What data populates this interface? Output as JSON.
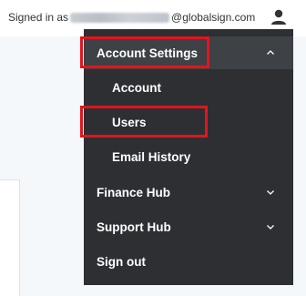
{
  "header": {
    "signed_in_prefix": "Signed in as",
    "email_domain": "@globalsign.com",
    "user_icon": "user-icon"
  },
  "menu": {
    "section": {
      "label": "Account Settings",
      "expanded": true,
      "icon": "chevron-up-icon"
    },
    "subitems": [
      {
        "label": "Account"
      },
      {
        "label": "Users"
      },
      {
        "label": "Email History"
      }
    ],
    "hubs": [
      {
        "label": "Finance Hub",
        "icon": "chevron-down-icon"
      },
      {
        "label": "Support Hub",
        "icon": "chevron-down-icon"
      }
    ],
    "sign_out": "Sign out"
  },
  "colors": {
    "menu_bg": "#2d2f33",
    "section_bg": "#3e4146",
    "highlight": "#e3141d",
    "page_bg": "#f5f8fb"
  }
}
